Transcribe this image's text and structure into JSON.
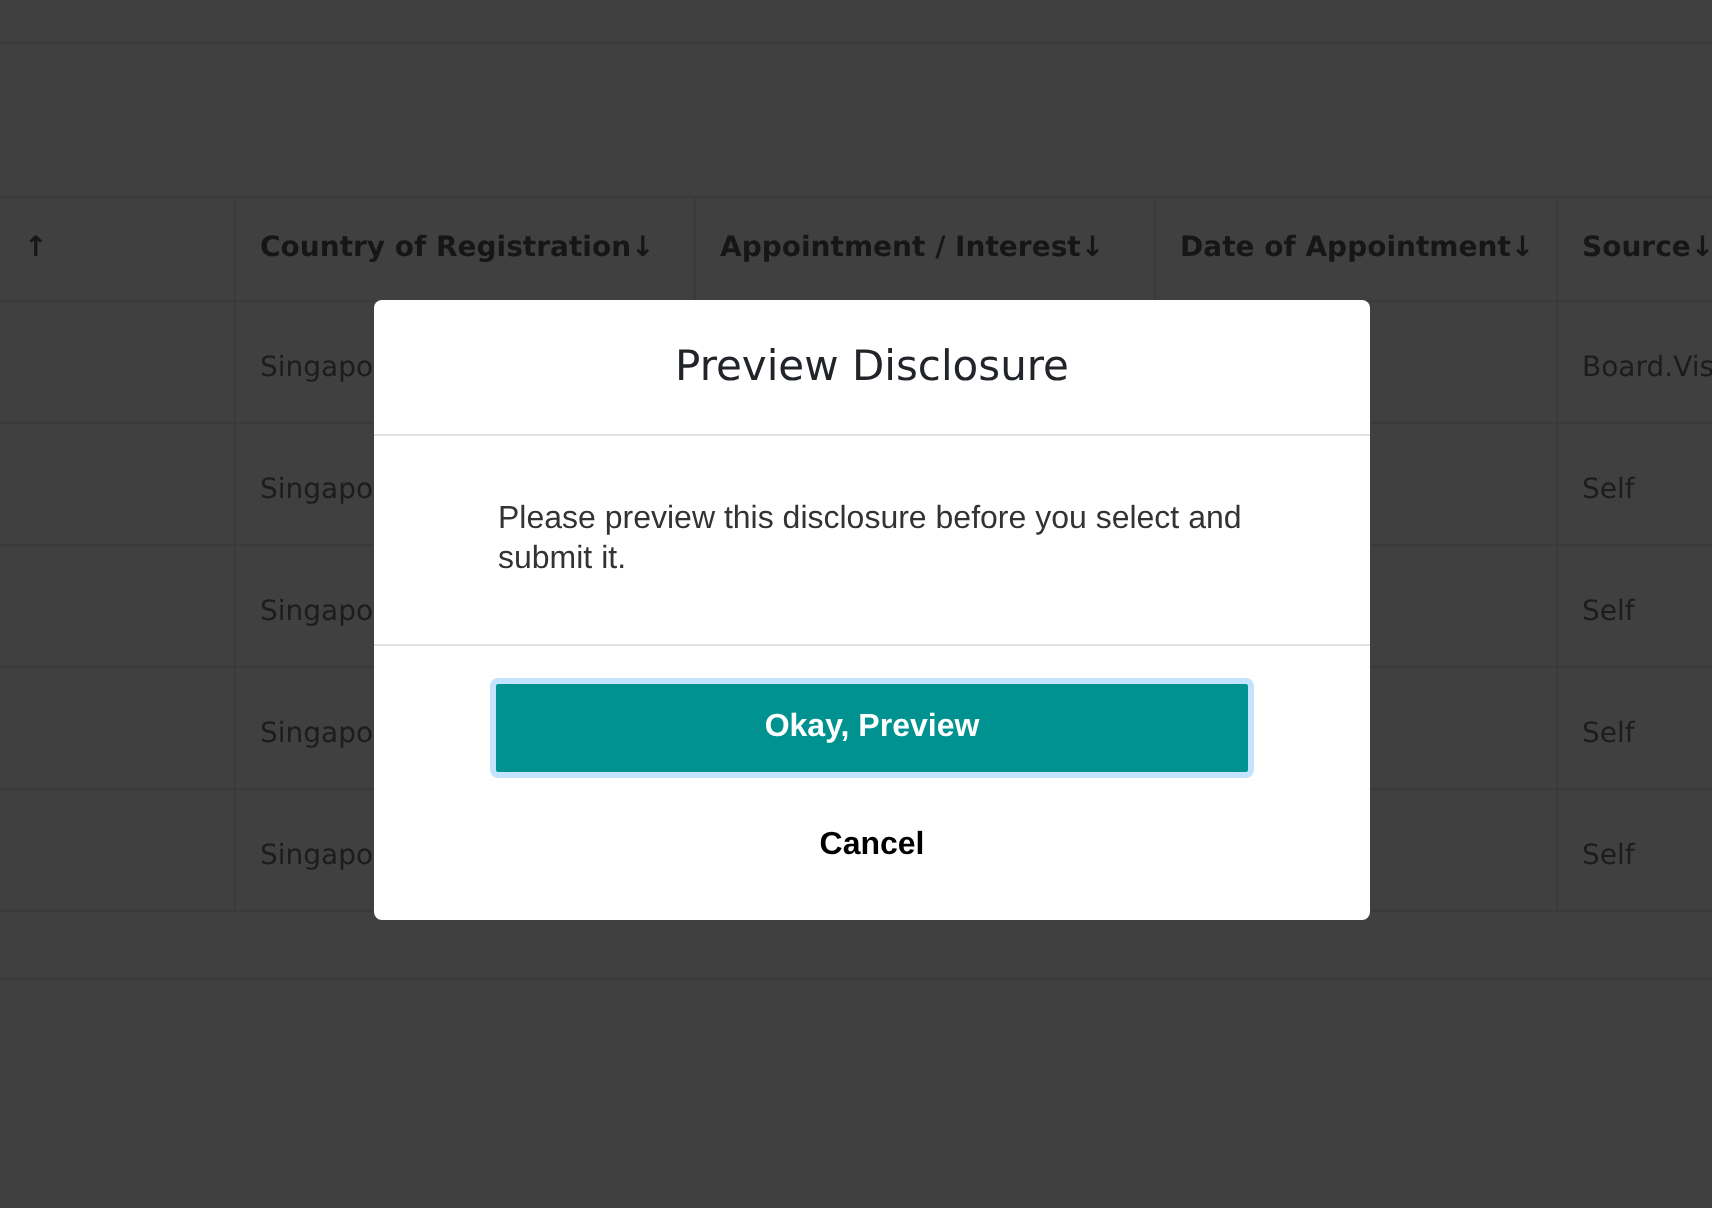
{
  "table": {
    "columns": [
      "↑",
      "Country of Registration↓",
      "Appointment / Interest↓",
      "Date of Appointment↓",
      "Source↓"
    ],
    "rows": [
      [
        "",
        "Singapo",
        "",
        "",
        "Board.Vis"
      ],
      [
        "",
        "Singapo",
        "",
        "",
        "Self"
      ],
      [
        "",
        "Singapo",
        "",
        "",
        "Self"
      ],
      [
        "",
        "Singapo",
        "",
        "",
        "Self"
      ],
      [
        "",
        "Singapo",
        "",
        "",
        "Self"
      ]
    ]
  },
  "dialog": {
    "title": "Preview Disclosure",
    "message": "Please preview this disclosure before you select and submit it.",
    "primary_button": "Okay, Preview",
    "secondary_button": "Cancel"
  }
}
